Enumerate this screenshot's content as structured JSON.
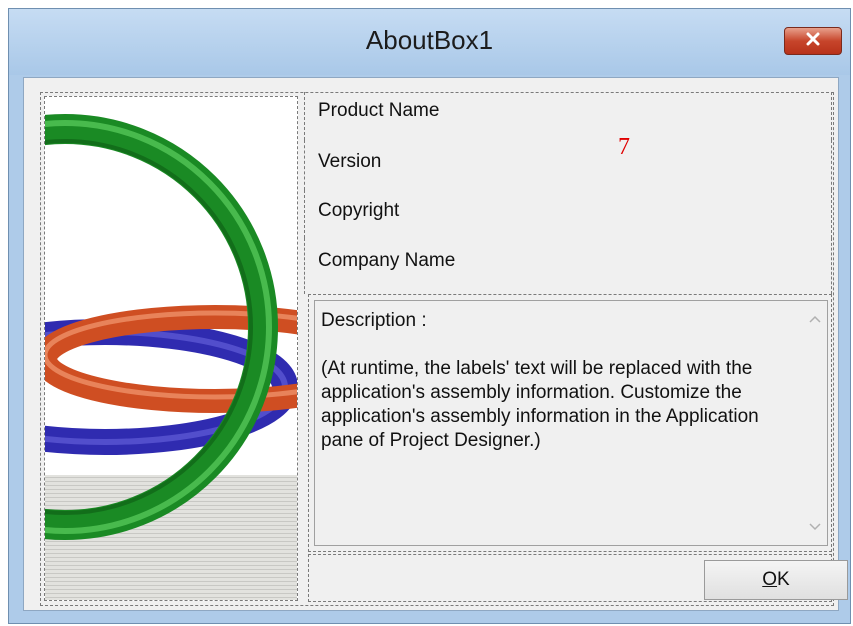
{
  "window": {
    "title": "AboutBox1"
  },
  "labels": {
    "product_name": "Product Name",
    "version": "Version",
    "copyright": "Copyright",
    "company_name": "Company Name"
  },
  "description": {
    "heading": "Description :",
    "body": "(At runtime, the labels' text will be replaced with the application's assembly information. Customize the application's assembly information in the Application pane of Project Designer.)"
  },
  "buttons": {
    "ok_label": "OK",
    "ok_mnemonic": "O",
    "ok_rest": "K"
  },
  "overlay": {
    "marker": "7"
  },
  "colors": {
    "titlebar": "#aecbe9",
    "close_button": "#c7452b",
    "ring_green": "#1f8f2a",
    "ring_orange": "#d6582c",
    "ring_blue": "#3a36b8",
    "marker_red": "#e00000"
  },
  "icons": {
    "close": "close-icon",
    "scroll_up": "chevron-up-icon",
    "scroll_down": "chevron-down-icon",
    "logo": "rings-logo-image"
  }
}
